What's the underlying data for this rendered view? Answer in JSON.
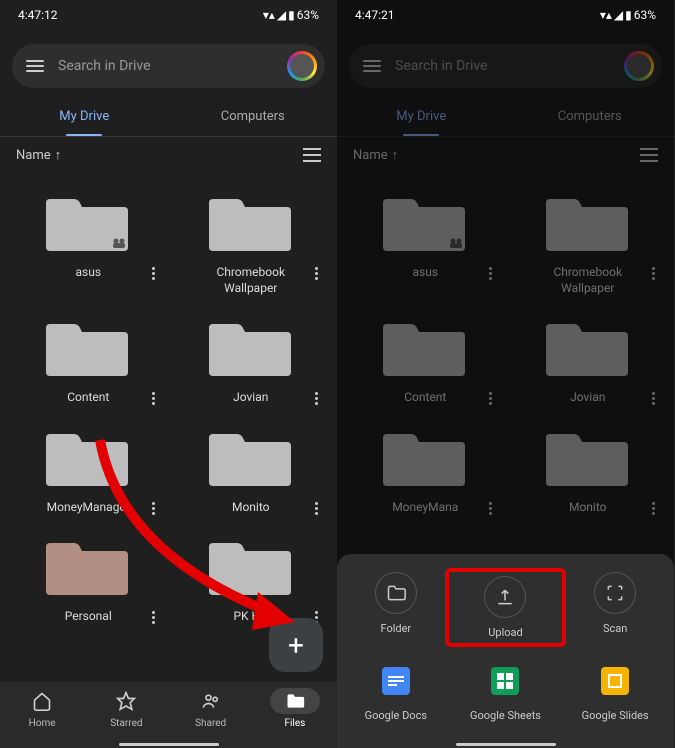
{
  "status": {
    "time_left": "4:47:12",
    "time_right": "4:47:21",
    "battery": "63%"
  },
  "search": {
    "placeholder": "Search in Drive"
  },
  "tabs": [
    {
      "label": "My Drive",
      "active": true
    },
    {
      "label": "Computers",
      "active": false
    }
  ],
  "sort": {
    "label": "Name"
  },
  "folders": [
    {
      "label": "asus",
      "shared": true
    },
    {
      "label": "Chromebook Wallpaper"
    },
    {
      "label": "Content"
    },
    {
      "label": "Jovian"
    },
    {
      "label": "MoneyManager"
    },
    {
      "label": "Monito"
    },
    {
      "label": "Personal",
      "color": "#b38e82"
    },
    {
      "label": "PK HD",
      "refresh": true
    }
  ],
  "folders_right": [
    {
      "label": "asus",
      "shared": true
    },
    {
      "label": "Chromebook Wallpaper"
    },
    {
      "label": "Content"
    },
    {
      "label": "Jovian"
    },
    {
      "label": "MoneyMana"
    },
    {
      "label": "Monito"
    }
  ],
  "nav": [
    {
      "label": "Home",
      "icon": "home"
    },
    {
      "label": "Starred",
      "icon": "star"
    },
    {
      "label": "Shared",
      "icon": "shared"
    },
    {
      "label": "Files",
      "icon": "files",
      "active": true
    }
  ],
  "sheet": [
    {
      "label": "Folder",
      "icon": "folder"
    },
    {
      "label": "Upload",
      "icon": "upload",
      "highlight": true
    },
    {
      "label": "Scan",
      "icon": "scan"
    },
    {
      "label": "Google Docs",
      "icon": "docs",
      "color": "#4285f4"
    },
    {
      "label": "Google Sheets",
      "icon": "sheets",
      "color": "#0f9d58"
    },
    {
      "label": "Google Slides",
      "icon": "slides",
      "color": "#f4b400"
    }
  ]
}
